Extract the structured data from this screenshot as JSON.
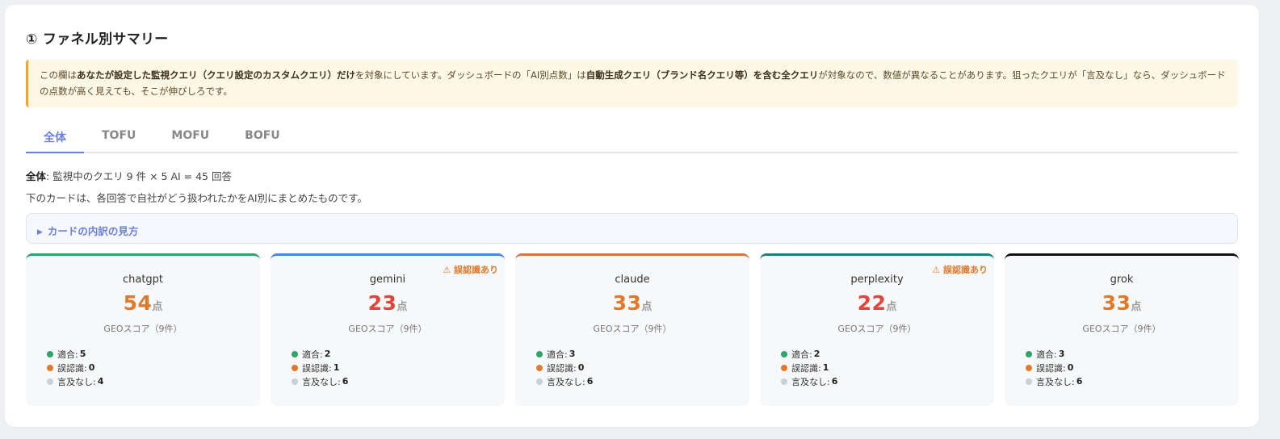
{
  "section": {
    "title": "① ファネル別サマリー"
  },
  "notice": {
    "t1": "この欄は",
    "b1": "あなたが設定した監視クエリ（クエリ設定のカスタムクエリ）だけ",
    "t2": "を対象にしています。ダッシュボードの「AI別点数」は",
    "b2": "自動生成クエリ（ブランド名クエリ等）を含む全クエリ",
    "t3": "が対象なので、数値が異なることがあります。狙ったクエリが「言及なし」なら、ダッシュボードの点数が高く見えても、そこが伸びしろです。"
  },
  "tabs": [
    "全体",
    "TOFU",
    "MOFU",
    "BOFU"
  ],
  "summary": {
    "label": "全体",
    "text": ": 監視中のクエリ 9 件 × 5 AI = 45 回答",
    "description": "下のカードは、各回答で自社がどう扱われたかをAI別にまとめたものです。"
  },
  "details": {
    "label": "カードの内訳の見方",
    "arrow_icon": "triangle-right-icon"
  },
  "card_labels": {
    "unit": "点",
    "score_label": "GEOスコア（9件）",
    "warning": "⚠ 誤認識あり",
    "fit": "適合:",
    "misrecognized": "誤認識:",
    "no_mention": "言及なし:"
  },
  "cards": [
    {
      "name": "chatgpt",
      "score": "54",
      "score_color": "#e07a2a",
      "accent": "#2fa36b",
      "warning": false,
      "fit": "5",
      "misrecognized": "0",
      "no_mention": "4"
    },
    {
      "name": "gemini",
      "score": "23",
      "score_color": "#e0443a",
      "accent": "#4a86e8",
      "warning": true,
      "fit": "2",
      "misrecognized": "1",
      "no_mention": "6"
    },
    {
      "name": "claude",
      "score": "33",
      "score_color": "#e07a2a",
      "accent": "#d9744a",
      "warning": false,
      "fit": "3",
      "misrecognized": "0",
      "no_mention": "6"
    },
    {
      "name": "perplexity",
      "score": "22",
      "score_color": "#e0443a",
      "accent": "#1a7f7a",
      "warning": true,
      "fit": "2",
      "misrecognized": "1",
      "no_mention": "6"
    },
    {
      "name": "grok",
      "score": "33",
      "score_color": "#e07a2a",
      "accent": "#111111",
      "warning": false,
      "fit": "3",
      "misrecognized": "0",
      "no_mention": "6"
    }
  ]
}
